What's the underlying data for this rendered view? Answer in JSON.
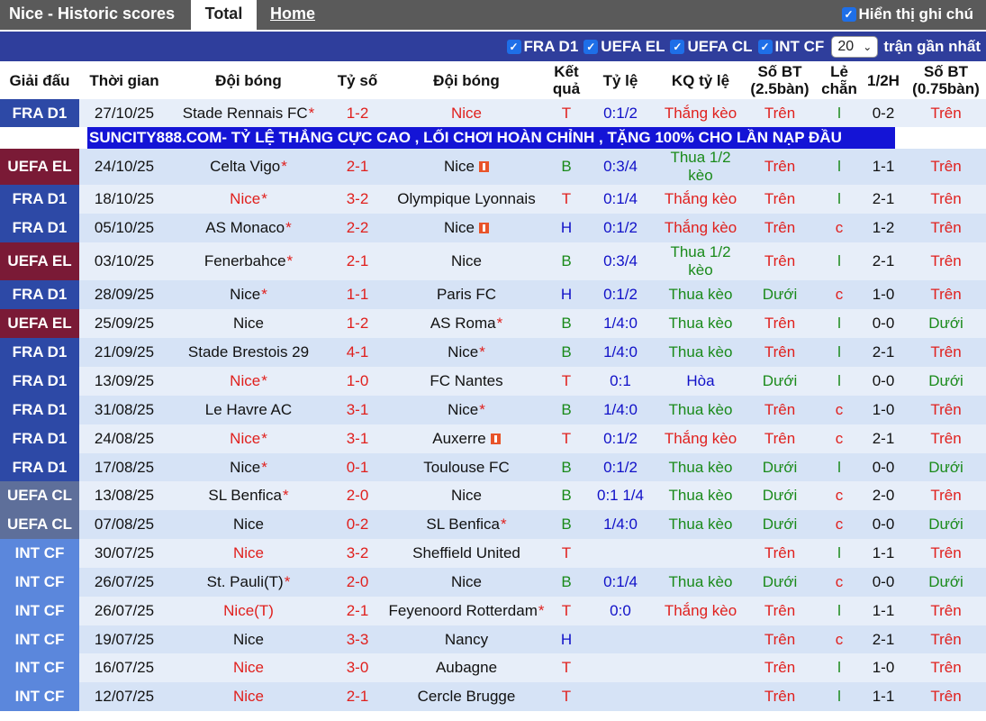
{
  "tabs": {
    "title": "Nice - Historic scores",
    "total": "Total",
    "home": "Home",
    "show_notes": "Hiển thị ghi chú"
  },
  "filters": {
    "items": [
      "FRA D1",
      "UEFA EL",
      "UEFA CL",
      "INT CF"
    ],
    "count_value": "20",
    "recent_label": "trận gần nhất"
  },
  "headers": [
    "Giải đấu",
    "Thời gian",
    "Đội bóng",
    "Tỷ số",
    "Đội bóng",
    "Kết quả",
    "Tỷ lệ",
    "KQ tỷ lệ",
    "Số BT (2.5bàn)",
    "Lẻ chẵn",
    "1/2H",
    "Số BT (0.75bàn)"
  ],
  "ad_text": "SUNCITY888.COM- TỶ LỆ THẮNG CỰC CAO , LỐI CHƠI HOÀN CHỈNH , TẶNG 100% CHO LẦN NẠP ĐẦU",
  "colors": {
    "FRA D1": "#2d49a6",
    "UEFA EL": "#7a1a36",
    "UEFA CL": "#5e6f9a",
    "INT CF": "#5b87dc"
  },
  "rows": [
    {
      "league": "FRA D1",
      "date": "27/10/25",
      "home": "Stade Rennais FC",
      "home_star": true,
      "home_red": false,
      "home_flag": false,
      "score": "1-2",
      "away": "Nice",
      "away_star": false,
      "away_red": true,
      "away_flag": false,
      "result": "T",
      "handicap": "0:1/2",
      "hres": "Thắng kèo",
      "ou": "Trên",
      "oe": "l",
      "half": "0-2",
      "ou2": "Trên"
    },
    {
      "league": "UEFA EL",
      "date": "24/10/25",
      "home": "Celta Vigo",
      "home_star": true,
      "home_red": false,
      "home_flag": false,
      "score": "2-1",
      "away": "Nice",
      "away_star": false,
      "away_red": false,
      "away_flag": true,
      "result": "B",
      "handicap": "0:3/4",
      "hres": "Thua 1/2 kèo",
      "ou": "Trên",
      "oe": "l",
      "half": "1-1",
      "ou2": "Trên"
    },
    {
      "league": "FRA D1",
      "date": "18/10/25",
      "home": "Nice",
      "home_star": true,
      "home_red": true,
      "home_flag": false,
      "score": "3-2",
      "away": "Olympique Lyonnais",
      "away_star": false,
      "away_red": false,
      "away_flag": false,
      "result": "T",
      "handicap": "0:1/4",
      "hres": "Thắng kèo",
      "ou": "Trên",
      "oe": "l",
      "half": "2-1",
      "ou2": "Trên"
    },
    {
      "league": "FRA D1",
      "date": "05/10/25",
      "home": "AS Monaco",
      "home_star": true,
      "home_red": false,
      "home_flag": false,
      "score": "2-2",
      "away": "Nice",
      "away_star": false,
      "away_red": false,
      "away_flag": true,
      "result": "H",
      "handicap": "0:1/2",
      "hres": "Thắng kèo",
      "ou": "Trên",
      "oe": "c",
      "half": "1-2",
      "ou2": "Trên"
    },
    {
      "league": "UEFA EL",
      "date": "03/10/25",
      "home": "Fenerbahce",
      "home_star": true,
      "home_red": false,
      "home_flag": false,
      "score": "2-1",
      "away": "Nice",
      "away_star": false,
      "away_red": false,
      "away_flag": false,
      "result": "B",
      "handicap": "0:3/4",
      "hres": "Thua 1/2 kèo",
      "ou": "Trên",
      "oe": "l",
      "half": "2-1",
      "ou2": "Trên"
    },
    {
      "league": "FRA D1",
      "date": "28/09/25",
      "home": "Nice",
      "home_star": true,
      "home_red": false,
      "home_flag": false,
      "score": "1-1",
      "away": "Paris FC",
      "away_star": false,
      "away_red": false,
      "away_flag": false,
      "result": "H",
      "handicap": "0:1/2",
      "hres": "Thua kèo",
      "ou": "Dưới",
      "oe": "c",
      "half": "1-0",
      "ou2": "Trên"
    },
    {
      "league": "UEFA EL",
      "date": "25/09/25",
      "home": "Nice",
      "home_star": false,
      "home_red": false,
      "home_flag": false,
      "score": "1-2",
      "away": "AS Roma",
      "away_star": true,
      "away_red": false,
      "away_flag": false,
      "result": "B",
      "handicap": "1/4:0",
      "hres": "Thua kèo",
      "ou": "Trên",
      "oe": "l",
      "half": "0-0",
      "ou2": "Dưới"
    },
    {
      "league": "FRA D1",
      "date": "21/09/25",
      "home": "Stade Brestois 29",
      "home_star": false,
      "home_red": false,
      "home_flag": false,
      "score": "4-1",
      "away": "Nice",
      "away_star": true,
      "away_red": false,
      "away_flag": false,
      "result": "B",
      "handicap": "1/4:0",
      "hres": "Thua kèo",
      "ou": "Trên",
      "oe": "l",
      "half": "2-1",
      "ou2": "Trên"
    },
    {
      "league": "FRA D1",
      "date": "13/09/25",
      "home": "Nice",
      "home_star": true,
      "home_red": true,
      "home_flag": false,
      "score": "1-0",
      "away": "FC Nantes",
      "away_star": false,
      "away_red": false,
      "away_flag": false,
      "result": "T",
      "handicap": "0:1",
      "hres": "Hòa",
      "ou": "Dưới",
      "oe": "l",
      "half": "0-0",
      "ou2": "Dưới"
    },
    {
      "league": "FRA D1",
      "date": "31/08/25",
      "home": "Le Havre AC",
      "home_star": false,
      "home_red": false,
      "home_flag": false,
      "score": "3-1",
      "away": "Nice",
      "away_star": true,
      "away_red": false,
      "away_flag": false,
      "result": "B",
      "handicap": "1/4:0",
      "hres": "Thua kèo",
      "ou": "Trên",
      "oe": "c",
      "half": "1-0",
      "ou2": "Trên"
    },
    {
      "league": "FRA D1",
      "date": "24/08/25",
      "home": "Nice",
      "home_star": true,
      "home_red": true,
      "home_flag": false,
      "score": "3-1",
      "away": "Auxerre",
      "away_star": false,
      "away_red": false,
      "away_flag": true,
      "result": "T",
      "handicap": "0:1/2",
      "hres": "Thắng kèo",
      "ou": "Trên",
      "oe": "c",
      "half": "2-1",
      "ou2": "Trên"
    },
    {
      "league": "FRA D1",
      "date": "17/08/25",
      "home": "Nice",
      "home_star": true,
      "home_red": false,
      "home_flag": false,
      "score": "0-1",
      "away": "Toulouse FC",
      "away_star": false,
      "away_red": false,
      "away_flag": false,
      "result": "B",
      "handicap": "0:1/2",
      "hres": "Thua kèo",
      "ou": "Dưới",
      "oe": "l",
      "half": "0-0",
      "ou2": "Dưới"
    },
    {
      "league": "UEFA CL",
      "date": "13/08/25",
      "home": "SL Benfica",
      "home_star": true,
      "home_red": false,
      "home_flag": false,
      "score": "2-0",
      "away": "Nice",
      "away_star": false,
      "away_red": false,
      "away_flag": false,
      "result": "B",
      "handicap": "0:1 1/4",
      "hres": "Thua kèo",
      "ou": "Dưới",
      "oe": "c",
      "half": "2-0",
      "ou2": "Trên"
    },
    {
      "league": "UEFA CL",
      "date": "07/08/25",
      "home": "Nice",
      "home_star": false,
      "home_red": false,
      "home_flag": false,
      "score": "0-2",
      "away": "SL Benfica",
      "away_star": true,
      "away_red": false,
      "away_flag": false,
      "result": "B",
      "handicap": "1/4:0",
      "hres": "Thua kèo",
      "ou": "Dưới",
      "oe": "c",
      "half": "0-0",
      "ou2": "Dưới"
    },
    {
      "league": "INT CF",
      "date": "30/07/25",
      "home": "Nice",
      "home_star": false,
      "home_red": true,
      "home_flag": false,
      "score": "3-2",
      "away": "Sheffield United",
      "away_star": false,
      "away_red": false,
      "away_flag": false,
      "result": "T",
      "handicap": "",
      "hres": "",
      "ou": "Trên",
      "oe": "l",
      "half": "1-1",
      "ou2": "Trên"
    },
    {
      "league": "INT CF",
      "date": "26/07/25",
      "home": "St. Pauli(T)",
      "home_star": true,
      "home_red": false,
      "home_flag": false,
      "score": "2-0",
      "away": "Nice",
      "away_star": false,
      "away_red": false,
      "away_flag": false,
      "result": "B",
      "handicap": "0:1/4",
      "hres": "Thua kèo",
      "ou": "Dưới",
      "oe": "c",
      "half": "0-0",
      "ou2": "Dưới"
    },
    {
      "league": "INT CF",
      "date": "26/07/25",
      "home": "Nice(T)",
      "home_star": false,
      "home_red": true,
      "home_flag": false,
      "score": "2-1",
      "away": "Feyenoord Rotterdam",
      "away_star": true,
      "away_red": false,
      "away_flag": false,
      "result": "T",
      "handicap": "0:0",
      "hres": "Thắng kèo",
      "ou": "Trên",
      "oe": "l",
      "half": "1-1",
      "ou2": "Trên"
    },
    {
      "league": "INT CF",
      "date": "19/07/25",
      "home": "Nice",
      "home_star": false,
      "home_red": false,
      "home_flag": false,
      "score": "3-3",
      "away": "Nancy",
      "away_star": false,
      "away_red": false,
      "away_flag": false,
      "result": "H",
      "handicap": "",
      "hres": "",
      "ou": "Trên",
      "oe": "c",
      "half": "2-1",
      "ou2": "Trên"
    },
    {
      "league": "INT CF",
      "date": "16/07/25",
      "home": "Nice",
      "home_star": false,
      "home_red": true,
      "home_flag": false,
      "score": "3-0",
      "away": "Aubagne",
      "away_star": false,
      "away_red": false,
      "away_flag": false,
      "result": "T",
      "handicap": "",
      "hres": "",
      "ou": "Trên",
      "oe": "l",
      "half": "1-0",
      "ou2": "Trên"
    },
    {
      "league": "INT CF",
      "date": "12/07/25",
      "home": "Nice",
      "home_star": false,
      "home_red": true,
      "home_flag": false,
      "score": "2-1",
      "away": "Cercle Brugge",
      "away_star": false,
      "away_red": false,
      "away_flag": false,
      "result": "T",
      "handicap": "",
      "hres": "",
      "ou": "Trên",
      "oe": "l",
      "half": "1-1",
      "ou2": "Trên"
    }
  ]
}
